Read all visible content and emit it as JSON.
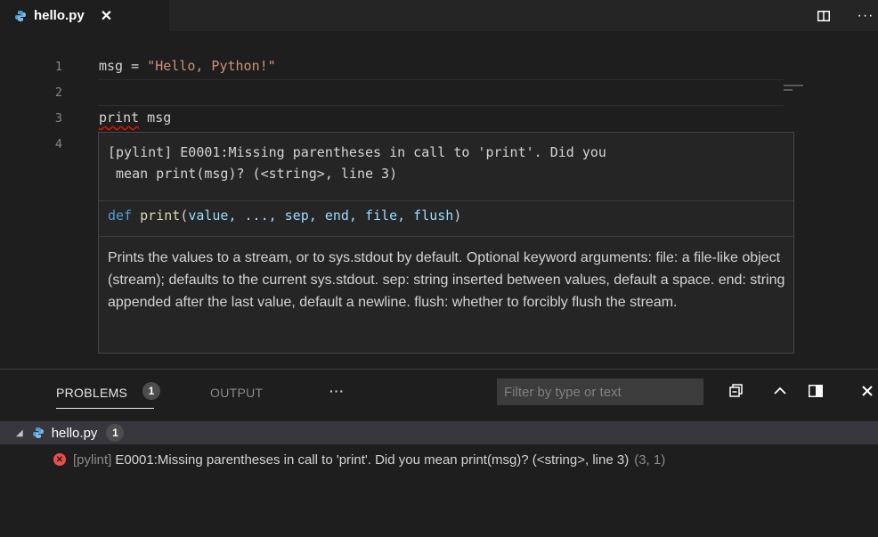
{
  "tab": {
    "filename": "hello.py",
    "close_glyph": "✕",
    "icon": "python-file-icon"
  },
  "editor_actions": {
    "split_icon": "split-editor-icon",
    "more_label": "···"
  },
  "line_numbers": [
    "1",
    "2",
    "3",
    "4"
  ],
  "code": {
    "line1_var": "msg = ",
    "line1_str": "\"Hello, Python!\"",
    "line3_kw": "print",
    "line3_rest": " msg"
  },
  "hover": {
    "error": "[pylint] E0001:Missing parentheses in call to 'print'. Did you\n mean print(msg)? (<string>, line 3)",
    "sig_def": "def",
    "sig_name": "print",
    "sig_open": "(",
    "sig_params": "value, ..., sep, end, file, flush",
    "sig_close": ")",
    "doc": "Prints the values to a stream, or to sys.stdout by default. Optional keyword arguments: file: a file-like object (stream); defaults to the current sys.stdout. sep: string inserted between values, default a space. end: string appended after the last value, default a newline. flush: whether to forcibly flush the stream."
  },
  "panel": {
    "problems_label": "PROBLEMS",
    "problems_count": "1",
    "output_label": "OUTPUT",
    "more_label": "···",
    "filter_placeholder": "Filter by type or text",
    "file_row": {
      "filename": "hello.py",
      "count": "1"
    },
    "error_row": {
      "source": "[pylint]",
      "message": "E0001:Missing parentheses in call to 'print'. Did you mean print(msg)? (<string>, line 3)",
      "location": "(3, 1)"
    }
  },
  "colors": {
    "editor_bg": "#1e1e1e",
    "string": "#ce9178",
    "keyword": "#569cd6",
    "function": "#dcdcaa",
    "error": "#f14c4c"
  }
}
